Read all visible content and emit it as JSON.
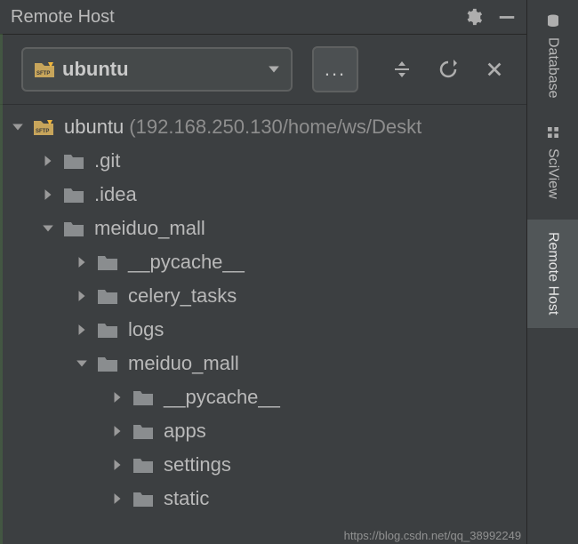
{
  "header": {
    "title": "Remote Host"
  },
  "toolbar": {
    "host_label": "ubuntu",
    "more_label": "..."
  },
  "tree": {
    "root_label": "ubuntu",
    "root_path": "(192.168.250.130/home/ws/Deskt",
    "items": [
      {
        "label": ".git",
        "indent": 1,
        "expanded": false
      },
      {
        "label": ".idea",
        "indent": 1,
        "expanded": false
      },
      {
        "label": "meiduo_mall",
        "indent": 1,
        "expanded": true
      },
      {
        "label": "__pycache__",
        "indent": 2,
        "expanded": false
      },
      {
        "label": "celery_tasks",
        "indent": 2,
        "expanded": false
      },
      {
        "label": "logs",
        "indent": 2,
        "expanded": false
      },
      {
        "label": "meiduo_mall",
        "indent": 2,
        "expanded": true
      },
      {
        "label": "__pycache__",
        "indent": 3,
        "expanded": false
      },
      {
        "label": "apps",
        "indent": 3,
        "expanded": false
      },
      {
        "label": "settings",
        "indent": 3,
        "expanded": false
      },
      {
        "label": "static",
        "indent": 3,
        "expanded": false
      }
    ]
  },
  "sidetabs": {
    "database": "Database",
    "sciview": "SciView",
    "remote": "Remote Host"
  },
  "watermark": "https://blog.csdn.net/qq_38992249"
}
